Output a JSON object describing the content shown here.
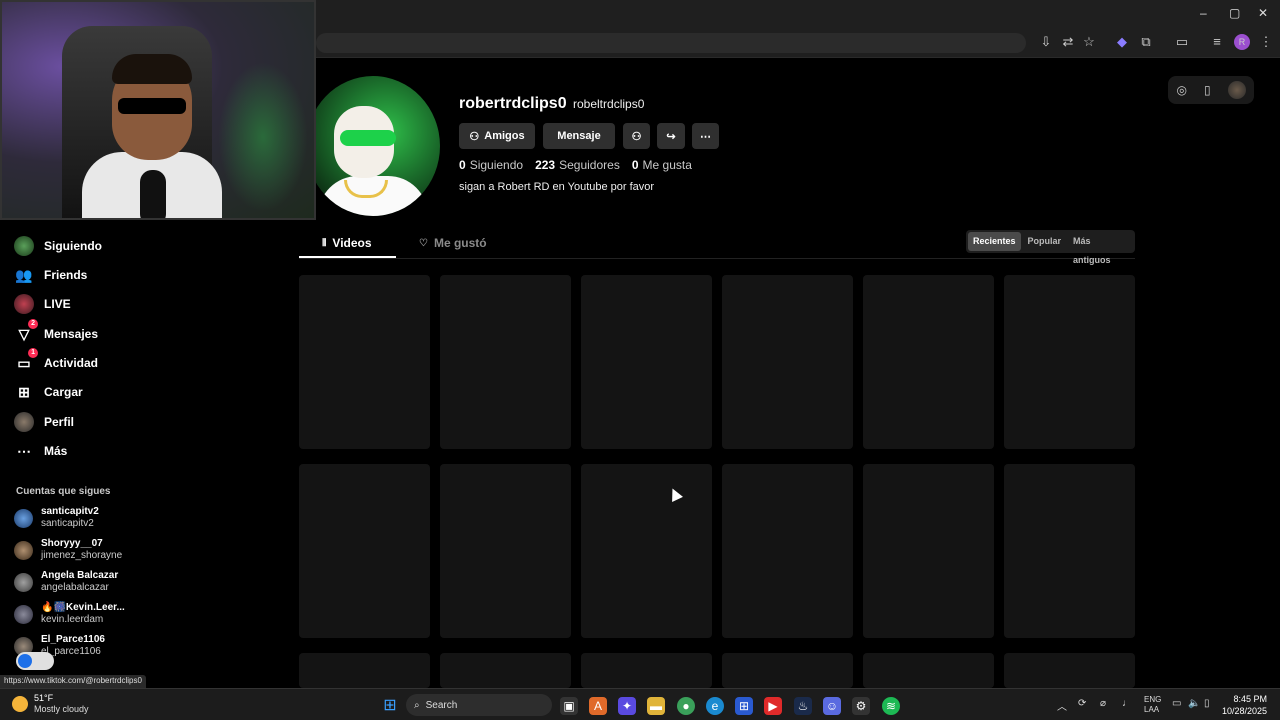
{
  "browser": {
    "window_controls": [
      "–",
      "▢",
      "✕"
    ]
  },
  "sidebar": {
    "items": [
      {
        "label": "Siguiendo",
        "icon": "following-avatar-icon"
      },
      {
        "label": "Friends",
        "icon": "friends-icon"
      },
      {
        "label": "LIVE",
        "icon": "live-icon"
      },
      {
        "label": "Mensajes",
        "icon": "messages-icon",
        "badge": "2"
      },
      {
        "label": "Actividad",
        "icon": "activity-icon",
        "badge": "1"
      },
      {
        "label": "Cargar",
        "icon": "upload-icon"
      },
      {
        "label": "Perfil",
        "icon": "profile-avatar-icon"
      },
      {
        "label": "Más",
        "icon": "more-icon"
      }
    ],
    "following_heading": "Cuentas que sigues",
    "following": [
      {
        "name": "santicapitv2",
        "handle": "santicapitv2"
      },
      {
        "name": "Shoryyy__07",
        "handle": "jimenez_shorayne"
      },
      {
        "name": "Angela Balcazar",
        "handle": "angelabalcazar"
      },
      {
        "name": "🔥🎆Kevin.Leer...",
        "handle": "kevin.leerdam"
      },
      {
        "name": "El_Parce1106",
        "handle": "el_parce1106"
      }
    ]
  },
  "profile": {
    "username": "robertrdclips0",
    "nickname": "robeltrdclips0",
    "buttons": {
      "friends": "Amigos",
      "message": "Mensaje"
    },
    "stats": {
      "following_count": "0",
      "following_label": "Siguiendo",
      "followers_count": "223",
      "followers_label": "Seguidores",
      "likes_count": "0",
      "likes_label": "Me gusta"
    },
    "bio": "sigan a Robert RD en Youtube por favor"
  },
  "tabs": {
    "videos": "Videos",
    "liked": "Me gustó"
  },
  "sort": {
    "options": [
      "Recientes",
      "Popular",
      "Más antiguos"
    ],
    "selected": "Recientes"
  },
  "status_url": "https://www.tiktok.com/@robertrdclips0",
  "taskbar": {
    "weather_temp": "51°F",
    "weather_desc": "Mostly cloudy",
    "search_placeholder": "Search",
    "lang_line1": "ENG",
    "lang_line2": "LAA",
    "time": "8:45 PM",
    "date": "10/28/2025"
  },
  "colors": {
    "accent": "#fe2c55",
    "background": "#000000",
    "tile": "#141414"
  }
}
